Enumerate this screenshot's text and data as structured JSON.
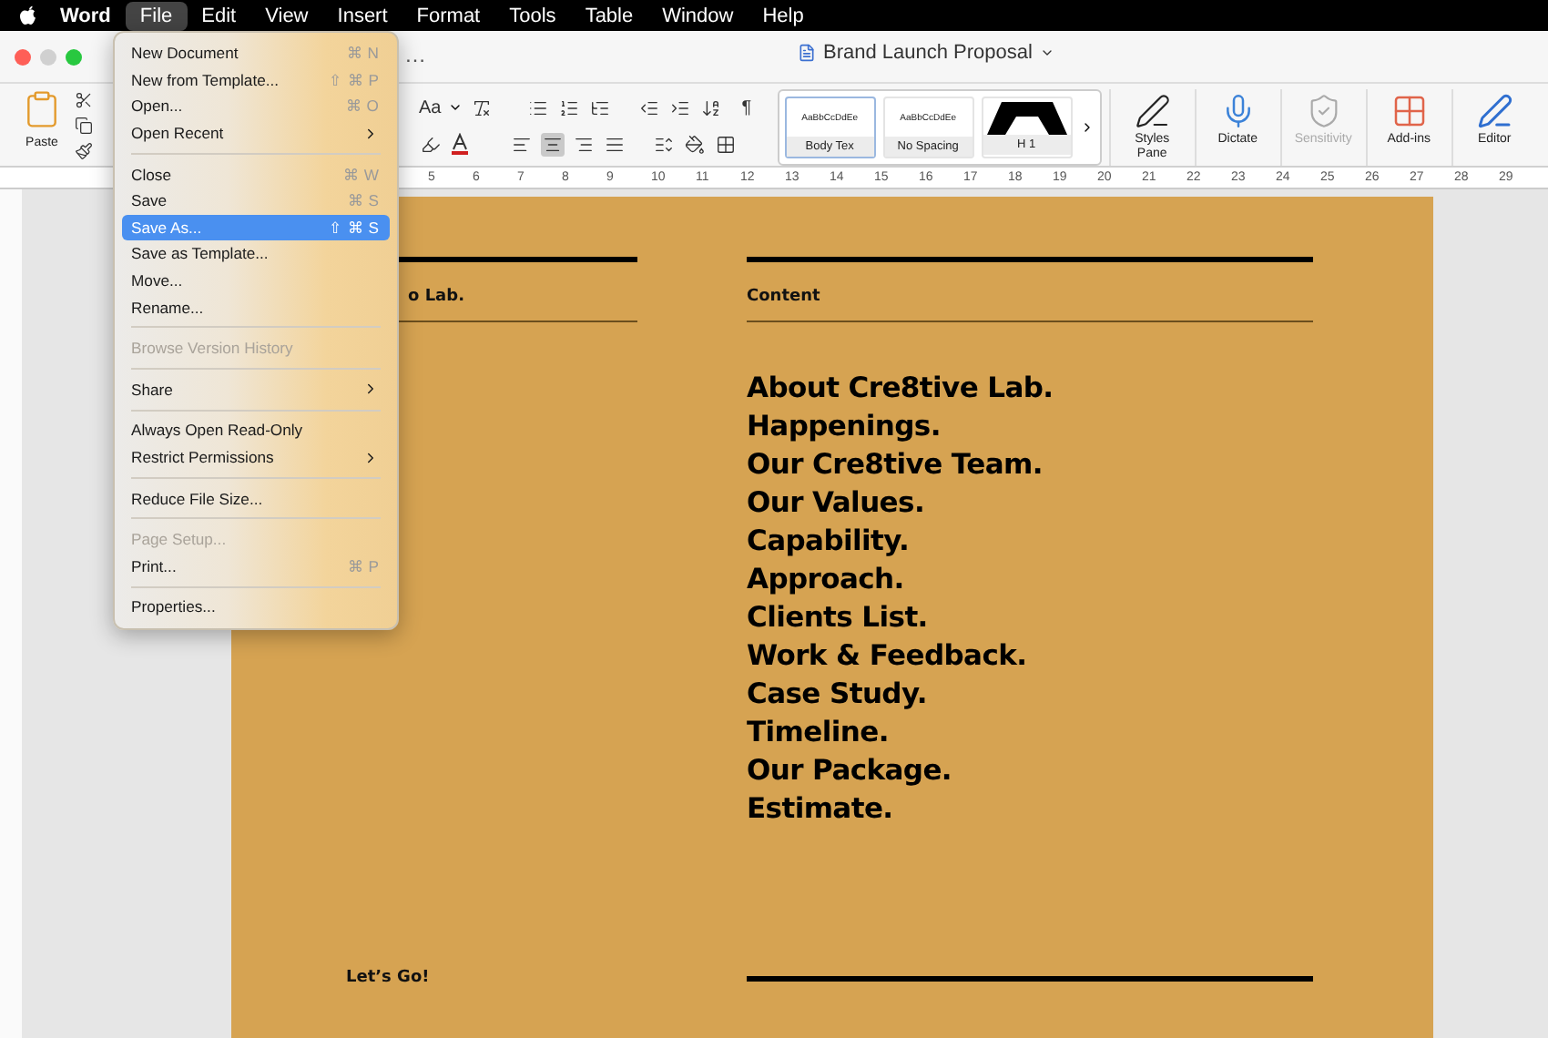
{
  "menu_bar": [
    {
      "label": "Word",
      "selected": false,
      "bold": true
    },
    {
      "label": "File",
      "selected": true,
      "bold": false
    },
    {
      "label": "Edit",
      "selected": false,
      "bold": false
    },
    {
      "label": "View",
      "selected": false,
      "bold": false
    },
    {
      "label": "Insert",
      "selected": false,
      "bold": false
    },
    {
      "label": "Format",
      "selected": false,
      "bold": false
    },
    {
      "label": "Tools",
      "selected": false,
      "bold": false
    },
    {
      "label": "Table",
      "selected": false,
      "bold": false
    },
    {
      "label": "Window",
      "selected": false,
      "bold": false
    },
    {
      "label": "Help",
      "selected": false,
      "bold": false
    }
  ],
  "window": {
    "title": "Brand Launch Proposal",
    "overflow": "…"
  },
  "ribbon": {
    "paste": "Paste",
    "font_case": "Aa",
    "pilcrow": "¶",
    "styles": [
      {
        "preview": "AaBbCcDdEe",
        "label": "Body Tex",
        "selected": true,
        "kind": "text"
      },
      {
        "preview": "AaBbCcDdEe",
        "label": "No Spacing",
        "selected": false,
        "kind": "text"
      },
      {
        "label": "H 1",
        "selected": false,
        "kind": "heading"
      }
    ],
    "tools": [
      {
        "label": "Styles Pane",
        "disabled": false,
        "kind": "styles"
      },
      {
        "label": "Dictate",
        "disabled": false,
        "kind": "mic"
      },
      {
        "label": "Sensitivity",
        "disabled": true,
        "kind": "sensitivity"
      },
      {
        "label": "Add-ins",
        "disabled": false,
        "kind": "addins"
      },
      {
        "label": "Editor",
        "disabled": false,
        "kind": "editor"
      }
    ],
    "alignment": [
      {
        "kind": "left",
        "selected": false
      },
      {
        "kind": "center",
        "selected": true
      },
      {
        "kind": "right",
        "selected": false
      },
      {
        "kind": "justify",
        "selected": false
      }
    ]
  },
  "ruler": [
    "5",
    "6",
    "7",
    "8",
    "9",
    "10",
    "11",
    "12",
    "13",
    "14",
    "15",
    "16",
    "17",
    "18",
    "19",
    "20",
    "21",
    "22",
    "23",
    "24",
    "25",
    "26",
    "27",
    "28",
    "29"
  ],
  "file_menu": [
    {
      "kind": "item",
      "label": "New Document",
      "shortcut": "⌘ N",
      "submenu": false,
      "disabled": false,
      "selected": false
    },
    {
      "kind": "item",
      "label": "New from Template...",
      "shortcut": "⇧ ⌘ P",
      "submenu": false,
      "disabled": false,
      "selected": false
    },
    {
      "kind": "item",
      "label": "Open...",
      "shortcut": "⌘ O",
      "submenu": false,
      "disabled": false,
      "selected": false
    },
    {
      "kind": "item",
      "label": "Open Recent",
      "submenu": true,
      "disabled": false,
      "selected": false
    },
    {
      "kind": "separator"
    },
    {
      "kind": "item",
      "label": "Close",
      "shortcut": "⌘ W",
      "submenu": false,
      "disabled": false,
      "selected": false
    },
    {
      "kind": "item",
      "label": "Save",
      "shortcut": "⌘ S",
      "submenu": false,
      "disabled": false,
      "selected": false
    },
    {
      "kind": "item",
      "label": "Save As...",
      "shortcut": "⇧ ⌘ S",
      "submenu": false,
      "disabled": false,
      "selected": true
    },
    {
      "kind": "item",
      "label": "Save as Template...",
      "submenu": false,
      "disabled": false,
      "selected": false
    },
    {
      "kind": "item",
      "label": "Move...",
      "submenu": false,
      "disabled": false,
      "selected": false
    },
    {
      "kind": "item",
      "label": "Rename...",
      "submenu": false,
      "disabled": false,
      "selected": false
    },
    {
      "kind": "separator"
    },
    {
      "kind": "item",
      "label": "Browse Version History",
      "submenu": false,
      "disabled": true,
      "selected": false
    },
    {
      "kind": "separator"
    },
    {
      "kind": "item",
      "label": "Share",
      "submenu": true,
      "disabled": false,
      "selected": false
    },
    {
      "kind": "separator"
    },
    {
      "kind": "item",
      "label": "Always Open Read-Only",
      "submenu": false,
      "disabled": false,
      "selected": false
    },
    {
      "kind": "item",
      "label": "Restrict Permissions",
      "submenu": true,
      "disabled": false,
      "selected": false
    },
    {
      "kind": "separator"
    },
    {
      "kind": "item",
      "label": "Reduce File Size...",
      "submenu": false,
      "disabled": false,
      "selected": false
    },
    {
      "kind": "separator"
    },
    {
      "kind": "item",
      "label": "Page Setup...",
      "submenu": false,
      "disabled": true,
      "selected": false
    },
    {
      "kind": "item",
      "label": "Print...",
      "shortcut": "⌘ P",
      "submenu": false,
      "disabled": false,
      "selected": false
    },
    {
      "kind": "separator"
    },
    {
      "kind": "item",
      "label": "Properties...",
      "submenu": false,
      "disabled": false,
      "selected": false
    }
  ],
  "document": {
    "left_heading": "o Lab.",
    "right_heading": "Content",
    "contents": [
      "About Cre8tive Lab.",
      "Happenings.",
      "Our Cre8tive Team.",
      "Our Values.",
      "Capability.",
      "Approach.",
      "Clients List.",
      "Work & Feedback.",
      "Case Study.",
      "Timeline.",
      "Our Package.",
      "Estimate."
    ],
    "footer": "Let’s Go!"
  }
}
